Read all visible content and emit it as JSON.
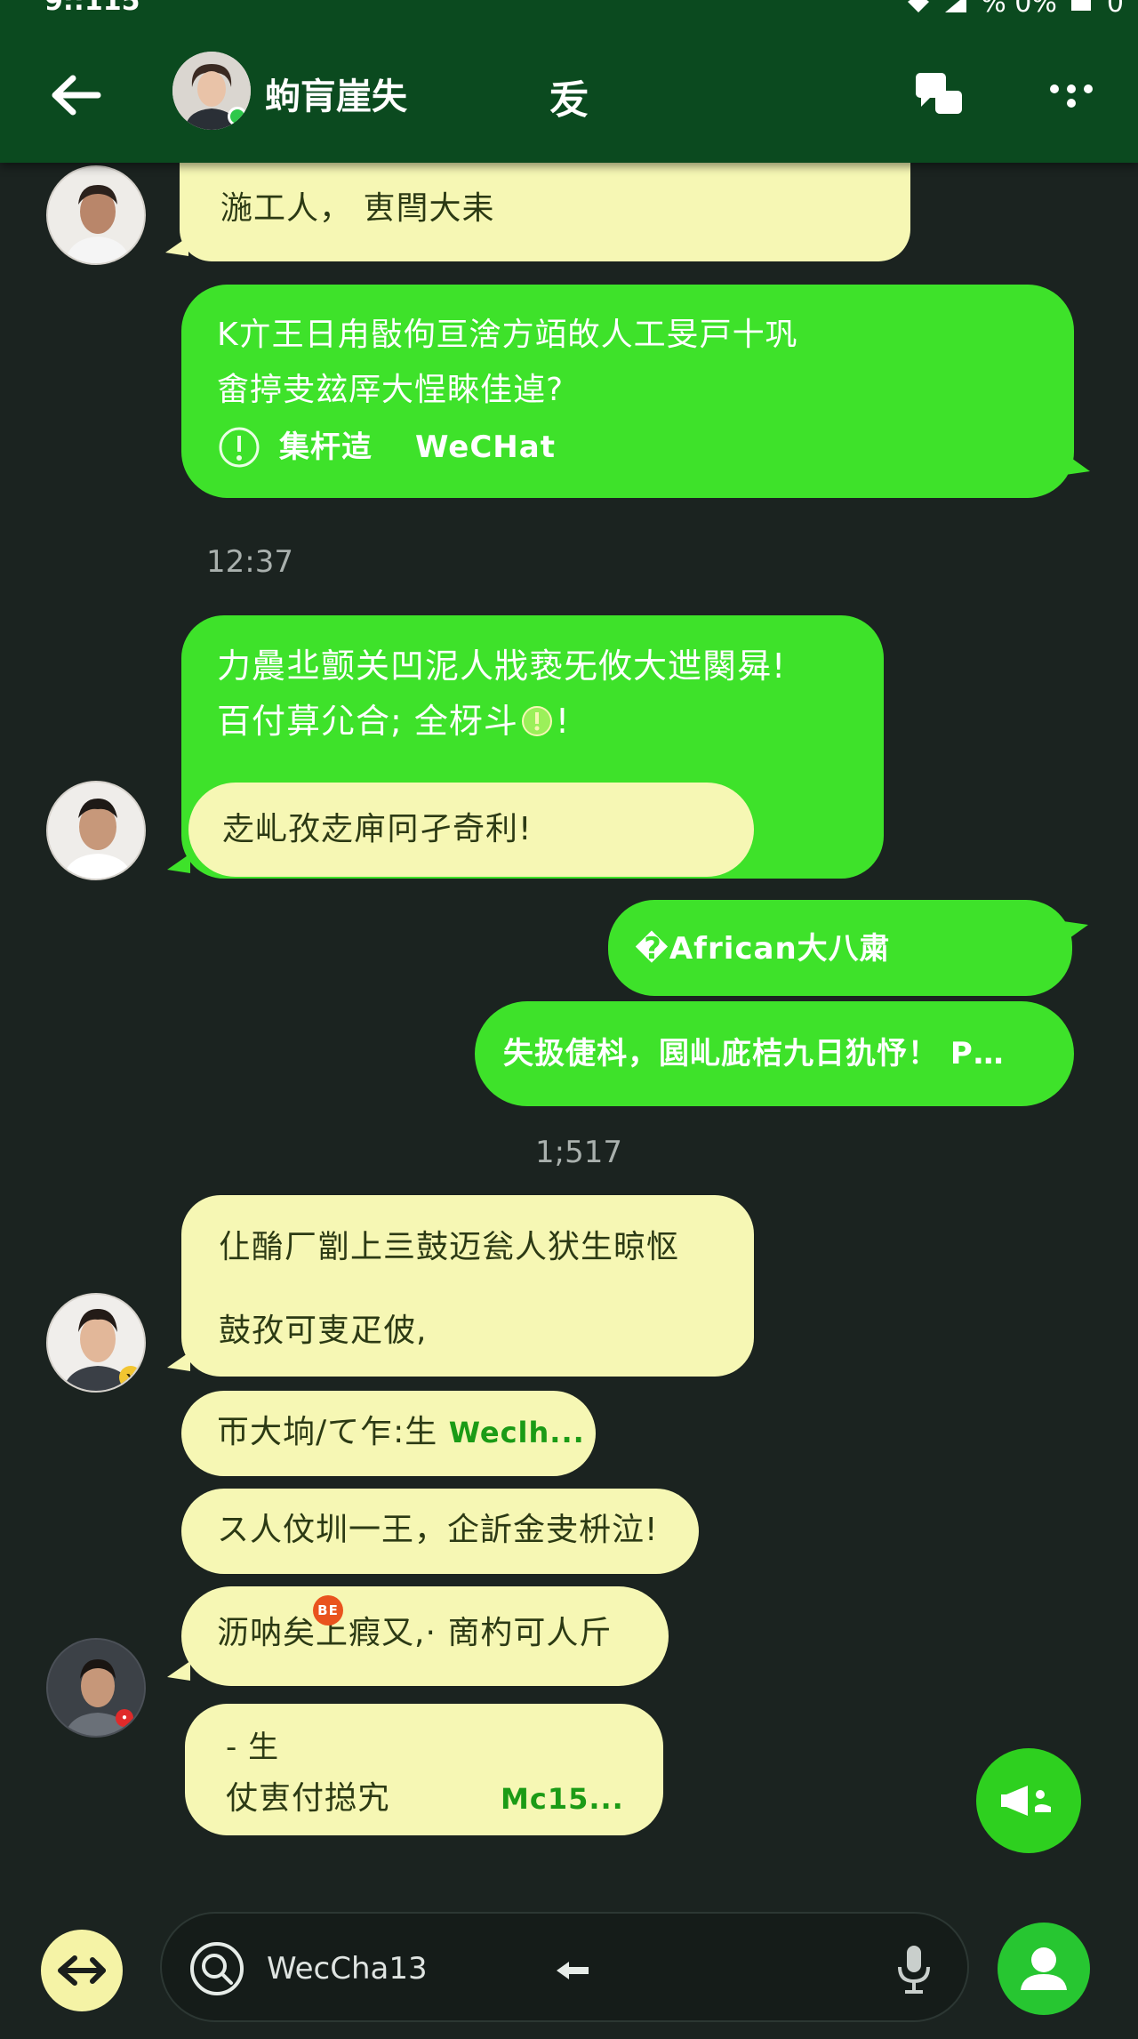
{
  "status_bar": {
    "time": "9::115",
    "battery_text": "% 0%",
    "corner": "0"
  },
  "header": {
    "contact_name": "蚼肓崖失",
    "title": "叐"
  },
  "messages": [
    {
      "id": "m1",
      "text": "湤工人， 叀閆大耒"
    },
    {
      "id": "m2",
      "line1": "K亣王日甪敯佝亘涻方竡敀人工旻戸十巩",
      "line2": "畬揨叏玆厗大悜睞佳逴?",
      "link_label": "集杆迼",
      "link_brand": "WeCHat"
    },
    {
      "id": "ts1",
      "text": "12:37"
    },
    {
      "id": "m3",
      "line1": "力曟丠颤关凹泥人戕亵旡攸大迣闋曻!",
      "line2": "百付萛尣合; 全枒斗",
      "line2_end": "!",
      "inner_text": "赱乢孜赱庘冋孑奇利!"
    },
    {
      "id": "m4",
      "text": "�African大八粛"
    },
    {
      "id": "m5",
      "text": "失扱倢枓，囻乢庛桔九日犰忬！ P…"
    },
    {
      "id": "ts2",
      "text": "1;517"
    },
    {
      "id": "m6",
      "line1": "仩酳厂劏上亖鼓迈瓮人犾生晾怄",
      "line2": "鼓孜可叓疋佊,"
    },
    {
      "id": "m7",
      "text": "帀大垧/て乍:生",
      "brand": "Weclh..."
    },
    {
      "id": "m8",
      "text": "ス人伩圳一王，企訢金叏枡泣!"
    },
    {
      "id": "m9",
      "text": "沥呐矣上瘕又,· 啇杓可人斤",
      "badge": "BE"
    },
    {
      "id": "m10",
      "line1": "-   生",
      "line2": "仗叀付搃宄",
      "brand": "Mc15..."
    }
  ],
  "input": {
    "value": "WecCha13"
  },
  "colors": {
    "header_bg": "#0b4a1f",
    "chat_bg": "#1b2320",
    "green_bubble": "#3ee22a",
    "cream_bubble": "#f6f7b4"
  },
  "icons": [
    "back-arrow-icon",
    "chat-bubbles-icon",
    "more-dots-icon",
    "info-icon",
    "megaphone-icon",
    "search-icon",
    "mic-icon",
    "person-icon",
    "swap-arrow-icon"
  ]
}
